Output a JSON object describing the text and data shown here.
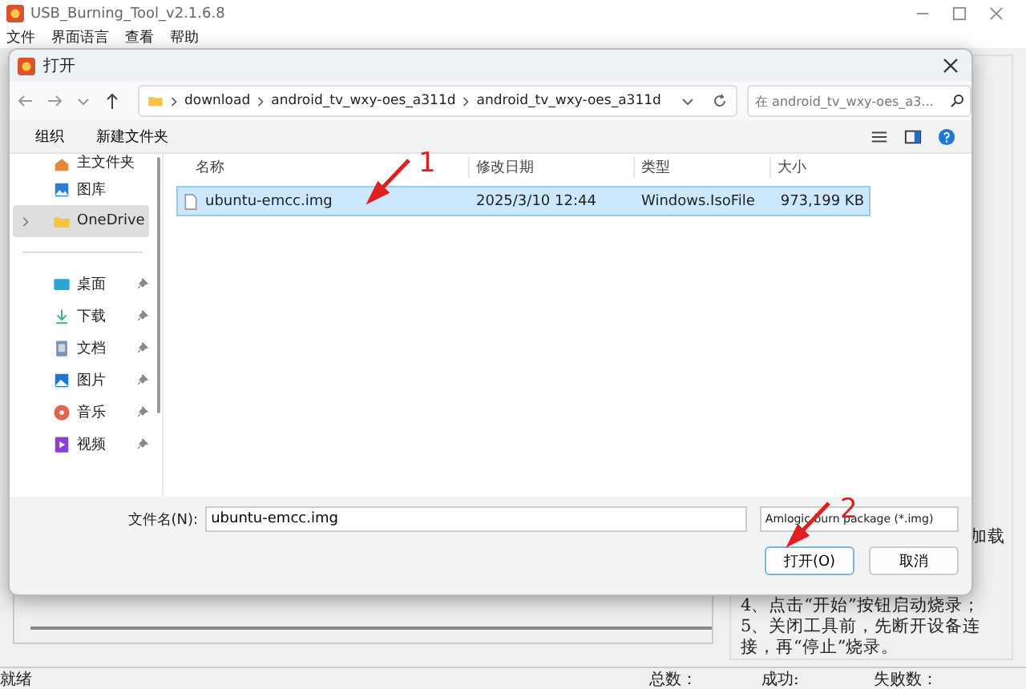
{
  "window": {
    "title": "USB_Burning_Tool_v2.1.6.8"
  },
  "menu": [
    "文件",
    "界面语言",
    "查看",
    "帮助"
  ],
  "background_panel": {
    "lines": [
      "加载",
      "4、点击“开始”按钮启动烧录；",
      "5、关闭工具前，先断开设备连",
      "接，再“停止”烧录。"
    ]
  },
  "status_bar": {
    "state": "就绪",
    "total": "总数：",
    "success": "成功:",
    "failed": "失败数："
  },
  "dialog": {
    "title": "打开",
    "breadcrumb": [
      "download",
      "android_tv_wxy-oes_a311d",
      "android_tv_wxy-oes_a311d"
    ],
    "search": {
      "placeholder": "在 android_tv_wxy-oes_a3..."
    },
    "toolbar": [
      "组织",
      "新建文件夹"
    ],
    "sidebar": [
      {
        "label": "主文件夹",
        "kind": "home",
        "pinned": false,
        "selected": false
      },
      {
        "label": "图库",
        "kind": "gallery",
        "pinned": false,
        "selected": false
      },
      {
        "label": "OneDrive",
        "kind": "folder",
        "pinned": false,
        "selected": true
      },
      {
        "label": "桌面",
        "kind": "desktop",
        "pinned": true,
        "selected": false
      },
      {
        "label": "下载",
        "kind": "download",
        "pinned": true,
        "selected": false
      },
      {
        "label": "文档",
        "kind": "document",
        "pinned": true,
        "selected": false
      },
      {
        "label": "图片",
        "kind": "pictures",
        "pinned": true,
        "selected": false
      },
      {
        "label": "音乐",
        "kind": "music",
        "pinned": true,
        "selected": false
      },
      {
        "label": "视频",
        "kind": "video",
        "pinned": true,
        "selected": false
      }
    ],
    "columns": [
      "名称",
      "修改日期",
      "类型",
      "大小"
    ],
    "rows": [
      {
        "name": "ubuntu-emcc.img",
        "date": "2025/3/10 12:44",
        "type": "Windows.IsoFile",
        "size": "973,199 KB",
        "selected": true
      }
    ],
    "filename_label": "文件名(N):",
    "filename": "ubuntu-emcc.img",
    "filetype": "Amlogic burn package (*.img)",
    "buttons": [
      "打开(O)",
      "取消"
    ]
  },
  "annotations": [
    {
      "label": "1"
    },
    {
      "label": "2"
    }
  ]
}
